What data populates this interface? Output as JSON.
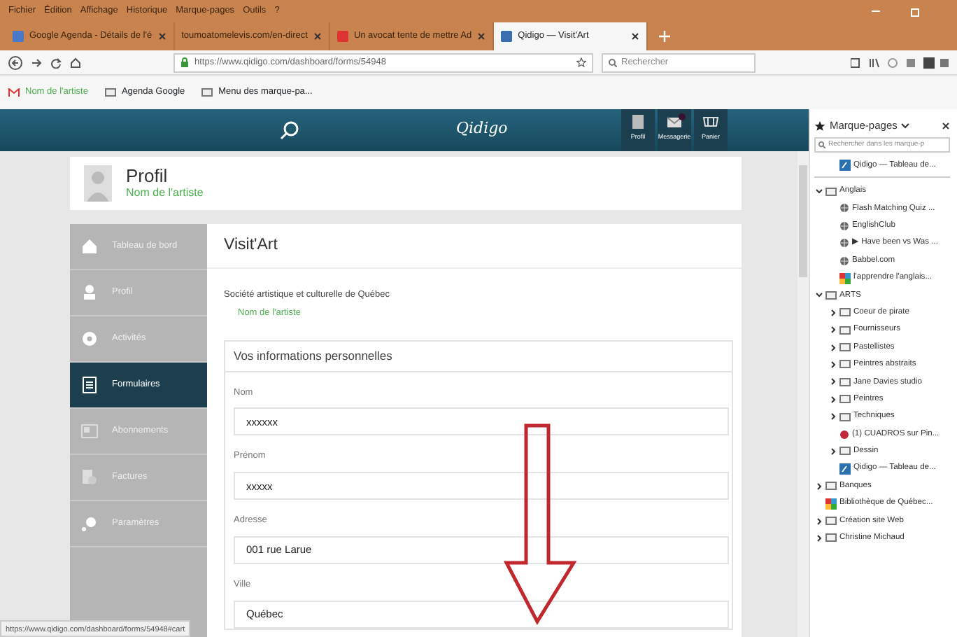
{
  "menu_bar": [
    "Fichier",
    "Édition",
    "Affichage",
    "Historique",
    "Marque-pages",
    "Outils",
    "?"
  ],
  "tabs": [
    {
      "label": "Google Agenda - Détails de l'é",
      "selected": false
    },
    {
      "label": "toumoatomelevis.com/en-direct",
      "selected": false
    },
    {
      "label": "Un avocat tente de mettre Ad",
      "selected": false
    },
    {
      "label": "Qidigo — Visit'Art",
      "selected": true
    }
  ],
  "address_bar": {
    "url": "https://www.qidigo.com/dashboard/forms/54948",
    "search_placeholder": "Rechercher"
  },
  "bookmarks_bar": [
    {
      "label": "Nom de l'artiste",
      "kind": "mail"
    },
    {
      "label": "Agenda Google",
      "kind": "folder"
    },
    {
      "label": "Menu des marque-pa...",
      "kind": "folder"
    }
  ],
  "site_header": {
    "logo": "Qidigo",
    "buttons": [
      {
        "label": "Profil",
        "notification": false
      },
      {
        "label": "Messagerie",
        "notification": true
      },
      {
        "label": "Panier",
        "notification": false
      }
    ]
  },
  "profile": {
    "title": "Profil",
    "name": "Nom de l'artiste"
  },
  "nav": [
    {
      "label": "Tableau de bord",
      "selected": false
    },
    {
      "label": "Profil",
      "selected": false
    },
    {
      "label": "Activités",
      "selected": false
    },
    {
      "label": "Formulaires",
      "selected": true
    },
    {
      "label": "Abonnements",
      "selected": false
    },
    {
      "label": "Factures",
      "selected": false
    },
    {
      "label": "Paramètres",
      "selected": false
    }
  ],
  "content": {
    "title": "Visit'Art",
    "organization": "Société artistique et culturelle de Québec",
    "artist": "Nom de l'artiste",
    "section_title": "Vos informations personnelles",
    "fields": [
      {
        "label": "Nom",
        "value": "xxxxxx"
      },
      {
        "label": "Prénom",
        "value": "xxxxx"
      },
      {
        "label": "Adresse",
        "value": "001 rue Larue"
      },
      {
        "label": "Ville",
        "value": "Québec"
      }
    ]
  },
  "status_url": "https://www.qidigo.com/dashboard/forms/54948#cart",
  "bookmarks_panel": {
    "title": "Marque-pages",
    "search_placeholder": "Rechercher dans les marque-p",
    "top": {
      "label": "Qidigo — Tableau de...",
      "kind": "qidigo"
    },
    "tree": [
      {
        "label": "Anglais",
        "kind": "folder",
        "expanded": true,
        "children": [
          {
            "label": "Flash Matching Quiz ...",
            "kind": "site"
          },
          {
            "label": "EnglishClub",
            "kind": "site"
          },
          {
            "label": "▶ Have been vs Was ...",
            "kind": "site"
          },
          {
            "label": "Babbel.com",
            "kind": "site"
          },
          {
            "label": "l'apprendre l'anglais...",
            "kind": "colorful"
          }
        ]
      },
      {
        "label": "ARTS",
        "kind": "folder",
        "expanded": true,
        "children": [
          {
            "label": "Coeur de pirate",
            "kind": "folder",
            "expanded": false
          },
          {
            "label": "Fournisseurs",
            "kind": "folder",
            "expanded": false
          },
          {
            "label": "Pastellistes",
            "kind": "folder",
            "expanded": false
          },
          {
            "label": "Peintres abstraits",
            "kind": "folder",
            "expanded": false
          },
          {
            "label": "Jane Davies studio",
            "kind": "folder",
            "expanded": false
          },
          {
            "label": "Peintres",
            "kind": "folder",
            "expanded": false
          },
          {
            "label": "Techniques",
            "kind": "folder",
            "expanded": false
          },
          {
            "label": "(1) CUADROS sur Pin...",
            "kind": "pin"
          },
          {
            "label": "Dessin",
            "kind": "folder",
            "expanded": false
          },
          {
            "label": "Qidigo — Tableau de...",
            "kind": "qidigo"
          }
        ]
      },
      {
        "label": "Banques",
        "kind": "folder",
        "expanded": false
      },
      {
        "label": "Bibliothèque de Québec...",
        "kind": "colorful"
      },
      {
        "label": "Création site Web",
        "kind": "folder",
        "expanded": false
      },
      {
        "label": "Christine Michaud",
        "kind": "folder",
        "expanded": false
      }
    ]
  }
}
